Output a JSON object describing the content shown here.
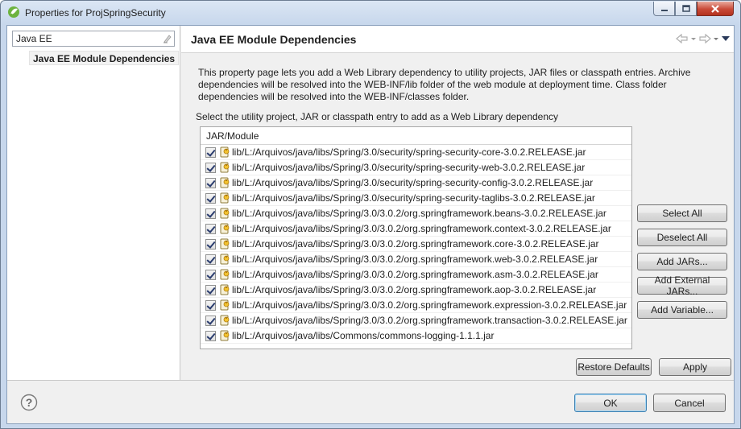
{
  "window": {
    "title": "Properties for ProjSpringSecurity"
  },
  "filter": {
    "value": "Java EE"
  },
  "tree": {
    "selected_item": "Java EE Module Dependencies"
  },
  "page": {
    "title": "Java EE Module Dependencies",
    "description": "This property page lets you add a Web Library dependency to utility projects, JAR files or classpath entries. Archive dependencies will be resolved into the WEB-INF/lib folder of the web module at deployment time. Class folder dependencies will be resolved into the WEB-INF/classes folder.",
    "select_label": "Select the utility project, JAR or classpath entry to add as a Web Library dependency"
  },
  "table": {
    "header": "JAR/Module",
    "rows": [
      {
        "path": "lib/L:/Arquivos/java/libs/Spring/3.0/security/spring-security-core-3.0.2.RELEASE.jar",
        "checked": true
      },
      {
        "path": "lib/L:/Arquivos/java/libs/Spring/3.0/security/spring-security-web-3.0.2.RELEASE.jar",
        "checked": true
      },
      {
        "path": "lib/L:/Arquivos/java/libs/Spring/3.0/security/spring-security-config-3.0.2.RELEASE.jar",
        "checked": true
      },
      {
        "path": "lib/L:/Arquivos/java/libs/Spring/3.0/security/spring-security-taglibs-3.0.2.RELEASE.jar",
        "checked": true
      },
      {
        "path": "lib/L:/Arquivos/java/libs/Spring/3.0/3.0.2/org.springframework.beans-3.0.2.RELEASE.jar",
        "checked": true
      },
      {
        "path": "lib/L:/Arquivos/java/libs/Spring/3.0/3.0.2/org.springframework.context-3.0.2.RELEASE.jar",
        "checked": true
      },
      {
        "path": "lib/L:/Arquivos/java/libs/Spring/3.0/3.0.2/org.springframework.core-3.0.2.RELEASE.jar",
        "checked": true
      },
      {
        "path": "lib/L:/Arquivos/java/libs/Spring/3.0/3.0.2/org.springframework.web-3.0.2.RELEASE.jar",
        "checked": true
      },
      {
        "path": "lib/L:/Arquivos/java/libs/Spring/3.0/3.0.2/org.springframework.asm-3.0.2.RELEASE.jar",
        "checked": true
      },
      {
        "path": "lib/L:/Arquivos/java/libs/Spring/3.0/3.0.2/org.springframework.aop-3.0.2.RELEASE.jar",
        "checked": true
      },
      {
        "path": "lib/L:/Arquivos/java/libs/Spring/3.0/3.0.2/org.springframework.expression-3.0.2.RELEASE.jar",
        "checked": true
      },
      {
        "path": "lib/L:/Arquivos/java/libs/Spring/3.0/3.0.2/org.springframework.transaction-3.0.2.RELEASE.jar",
        "checked": true
      },
      {
        "path": "lib/L:/Arquivos/java/libs/Commons/commons-logging-1.1.1.jar",
        "checked": true
      }
    ]
  },
  "side_buttons": {
    "select_all": "Select All",
    "deselect_all": "Deselect All",
    "add_jars": "Add JARs...",
    "add_external_jars": "Add External JARs...",
    "add_variable": "Add Variable..."
  },
  "footer": {
    "restore_defaults": "Restore Defaults",
    "apply": "Apply",
    "ok": "OK",
    "cancel": "Cancel"
  },
  "icons": {
    "app": "eclipse-spring-icon",
    "help": "help-icon",
    "back": "back-arrow-icon",
    "forward": "forward-arrow-icon",
    "menu": "view-menu-icon",
    "jar": "jar-file-icon"
  },
  "colors": {
    "title_gradient_top": "#dbe6f4",
    "close_button": "#c94a38",
    "checkmark": "#2a3c6e",
    "primary_button_border": "#3c7fb1"
  }
}
